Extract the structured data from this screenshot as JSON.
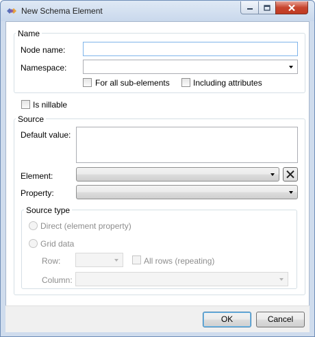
{
  "window": {
    "title": "New Schema Element",
    "icon": "schema-diamond-icon",
    "controls": [
      "minimize-icon",
      "maximize-icon",
      "close-icon"
    ]
  },
  "name_group": {
    "legend": "Name",
    "node_name_label": "Node name:",
    "node_name_value": "",
    "namespace_label": "Namespace:",
    "namespace_value": "",
    "for_all_sub_elements_label": "For all sub-elements",
    "for_all_sub_elements_checked": false,
    "including_attributes_label": "Including attributes",
    "including_attributes_checked": false
  },
  "is_nillable": {
    "label": "Is nillable",
    "checked": false
  },
  "source_group": {
    "legend": "Source",
    "default_value_label": "Default value:",
    "default_value": "",
    "element_label": "Element:",
    "element_value": "",
    "property_label": "Property:",
    "property_value": "",
    "source_type": {
      "legend": "Source type",
      "direct_label": "Direct (element property)",
      "grid_label": "Grid data",
      "row_label": "Row:",
      "row_value": "",
      "all_rows_label": "All rows (repeating)",
      "all_rows_checked": false,
      "column_label": "Column:",
      "column_value": ""
    }
  },
  "footer": {
    "ok_label": "OK",
    "cancel_label": "Cancel"
  },
  "colors": {
    "title_bar": "#c9d8ec",
    "close_button": "#c7452e",
    "focus_border": "#7eb4ea"
  }
}
